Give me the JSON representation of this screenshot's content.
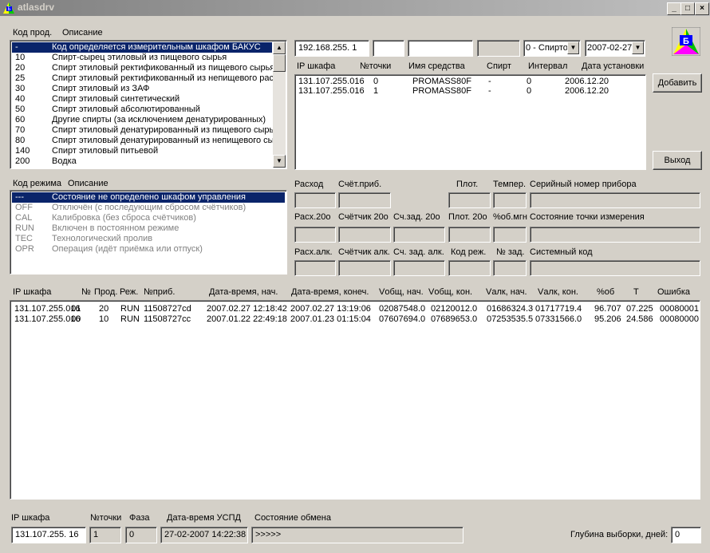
{
  "window": {
    "title": "atlasdrv",
    "min": "_",
    "max": "□",
    "close": "×"
  },
  "logo": {
    "letter": "Б"
  },
  "products": {
    "col_code": "Код прод.",
    "col_desc": "Описание",
    "items": [
      {
        "code": "-",
        "desc": "Код определяется измерительным шкафом БАКУС"
      },
      {
        "code": "10",
        "desc": "Спирт-сырец этиловый из пищевого сырья"
      },
      {
        "code": "20",
        "desc": "Спирт этиловый ректификованный из пищевого сырья"
      },
      {
        "code": "25",
        "desc": "Спирт этиловый ректификованный из непищевого раст"
      },
      {
        "code": "30",
        "desc": "Спирт этиловый из ЗАФ"
      },
      {
        "code": "40",
        "desc": "Спирт этиловый синтетический"
      },
      {
        "code": "50",
        "desc": "Спирт этиловый абсолютированный"
      },
      {
        "code": "60",
        "desc": "Другие спирты (за исключением денатурированных)"
      },
      {
        "code": "70",
        "desc": "Спирт этиловый денатурированный из пищевого сырь"
      },
      {
        "code": "80",
        "desc": "Спирт этиловый денатурированный из непищевого сыр"
      },
      {
        "code": "140",
        "desc": "Спирт этиловый питьевой"
      },
      {
        "code": "200",
        "desc": "Водка"
      }
    ]
  },
  "modes": {
    "col_code": "Код режима",
    "col_desc": "Описание",
    "items": [
      {
        "code": "---",
        "desc": "Состояние не определено шкафом управления"
      },
      {
        "code": "OFF",
        "desc": "Отключён (с последующим сбросом счётчиков)"
      },
      {
        "code": "CAL",
        "desc": "Калибровка (без сброса счётчиков)"
      },
      {
        "code": "RUN",
        "desc": "Включен в постоянном режиме"
      },
      {
        "code": "TEC",
        "desc": "Технологический пролив"
      },
      {
        "code": "OPR",
        "desc": "Операция (идёт приёмка или отпуск)"
      }
    ]
  },
  "filter": {
    "ip": "192.168.255.  1",
    "spirit": "0 - Спирто",
    "date": "2007-02-27"
  },
  "devices": {
    "headers": [
      "IP шкафа",
      "№точки",
      "Имя средства",
      "Спирт",
      "Интервал",
      "Дата установки"
    ],
    "rows": [
      [
        "131.107.255.016",
        "0",
        "PROMASS80F",
        "-",
        "0",
        "2006.12.20"
      ],
      [
        "131.107.255.016",
        "1",
        "PROMASS80F",
        "-",
        "0",
        "2006.12.20"
      ]
    ]
  },
  "buttons": {
    "add": "Добавить",
    "exit": "Выход"
  },
  "params": {
    "r1": [
      "Расход",
      "Счёт.приб.",
      "Плот.",
      "Темпер.",
      "Серийный номер прибора"
    ],
    "r2": [
      "Расх.20о",
      "Счётчик 20о",
      "Сч.зад. 20о",
      "Плот. 20о",
      "%об.мгн",
      "Состояние точки измерения"
    ],
    "r3": [
      "Расх.алк.",
      "Счётчик алк.",
      "Сч. зад. алк.",
      "Код реж.",
      "№ зад.",
      "Системный код"
    ]
  },
  "log": {
    "headers": [
      "IP шкафа",
      "№",
      "Прод.",
      "Реж.",
      "№приб.",
      "Дата-время, нач.",
      "Дата-время, конеч.",
      "Vобщ, нач.",
      "Vобщ, кон.",
      "Vалк, нач.",
      "Vалк, кон.",
      "%об",
      "T",
      "Ошибка"
    ],
    "rows": [
      [
        "131.107.255.016",
        "01",
        "20",
        "RUN",
        "11508727cd",
        "2007.02.27 12:18:42",
        "2007.02.27 13:19:06",
        "02087548.0",
        "02120012.0",
        "01686324.3",
        "01717719.4",
        "96.707",
        "07.225",
        "00080001"
      ],
      [
        "131.107.255.016",
        "00",
        "10",
        "RUN",
        "11508727cc",
        "2007.01.22 22:49:18",
        "2007.01.23 01:15:04",
        "07607694.0",
        "07689653.0",
        "07253535.5",
        "07331566.0",
        "95.206",
        "24.586",
        "00080000"
      ]
    ]
  },
  "footer": {
    "labels": [
      "IP шкафа",
      "№точки",
      "Фаза",
      "Дата-время УСПД",
      "Состояние обмена"
    ],
    "ip": "131.107.255. 16",
    "point": "1",
    "phase": "0",
    "datetime": "27-02-2007 14:22:38",
    "state": ">>>>>",
    "depth_label": "Глубина выборки, дней:",
    "depth": "0"
  }
}
